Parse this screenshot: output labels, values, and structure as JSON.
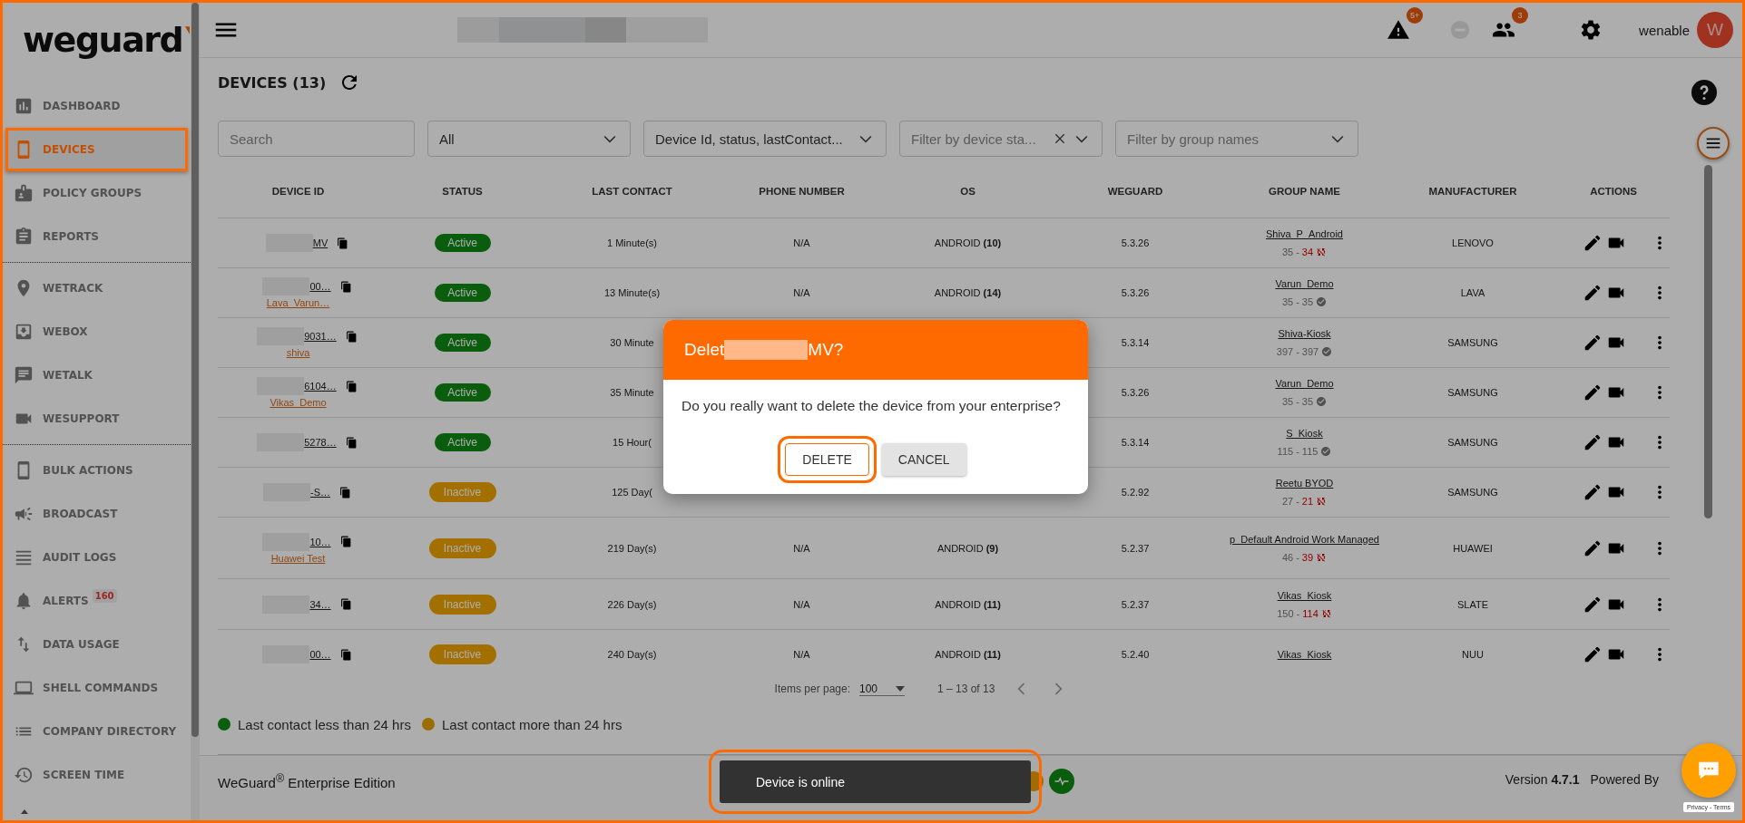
{
  "sidebar": {
    "logo": "weguard",
    "sections": [
      {
        "items": [
          {
            "label": "DASHBOARD",
            "selected": false
          },
          {
            "label": "DEVICES",
            "selected": true
          },
          {
            "label": "POLICY GROUPS",
            "selected": false
          },
          {
            "label": "REPORTS",
            "selected": false
          }
        ]
      },
      {
        "items": [
          {
            "label": "WETRACK",
            "selected": false
          },
          {
            "label": "WEBOX",
            "selected": false
          },
          {
            "label": "WETALK",
            "selected": false
          },
          {
            "label": "WESUPPORT",
            "selected": false
          }
        ]
      },
      {
        "items": [
          {
            "label": "BULK ACTIONS",
            "selected": false
          },
          {
            "label": "BROADCAST",
            "selected": false
          },
          {
            "label": "AUDIT LOGS",
            "selected": false
          },
          {
            "label": "ALERTS",
            "selected": false,
            "badge": "160"
          },
          {
            "label": "DATA USAGE",
            "selected": false
          },
          {
            "label": "SHELL COMMANDS",
            "selected": false
          },
          {
            "label": "COMPANY DIRECTORY",
            "selected": false
          },
          {
            "label": "SCREEN TIME",
            "selected": false
          }
        ]
      }
    ]
  },
  "header": {
    "alerts_badge": "5+",
    "users_badge": "3",
    "user_name": "wenable",
    "avatar_initial": "W"
  },
  "page": {
    "title": "DEVICES (13)"
  },
  "filters": [
    {
      "kind": "search",
      "placeholder": "Search"
    },
    {
      "kind": "select",
      "value": "All"
    },
    {
      "kind": "select",
      "value": "Device Id, status, lastContact..."
    },
    {
      "kind": "clearable",
      "placeholder": "Filter by device sta..."
    },
    {
      "kind": "select",
      "placeholder": "Filter by group names"
    }
  ],
  "table": {
    "columns": [
      "DEVICE ID",
      "STATUS",
      "LAST CONTACT",
      "PHONE NUMBER",
      "OS",
      "WEGUARD",
      "GROUP NAME",
      "MANUFACTURER",
      "ACTIONS"
    ],
    "rows": [
      {
        "device_id": "MV",
        "status": {
          "label": "Active",
          "active": true
        },
        "last_contact": "1 Minute(s)",
        "phone_number": "N/A",
        "os": "ANDROID **(10)**",
        "weguard": "5.3.26",
        "group_name": "Shiva_P_Android",
        "counts": {
          "total": "35",
          "separator": "-",
          "synced_count": "34",
          "synced": false
        },
        "manufacturer": "LENOVO"
      },
      {
        "device_id": "00…",
        "device_group": "Lava_Varun…",
        "status": {
          "label": "Active",
          "active": true
        },
        "last_contact": "13 Minute(s)",
        "phone_number": "N/A",
        "os": "ANDROID **(14)**",
        "weguard": "5.3.26",
        "group_name": "Varun_Demo",
        "counts": {
          "total": "35",
          "separator": "-",
          "synced_count": "35",
          "synced": true
        },
        "manufacturer": "LAVA"
      },
      {
        "device_id": "9031…",
        "device_group": "shiva",
        "status": {
          "label": "Active",
          "active": true
        },
        "last_contact": "30 Minute",
        "weguard": "5.3.14",
        "group_name": "Shiva-Kiosk",
        "counts": {
          "total": "397",
          "separator": "-",
          "synced_count": "397",
          "synced": true
        },
        "manufacturer": "SAMSUNG"
      },
      {
        "device_id": "6104…",
        "device_group": "Vikas_Demo",
        "status": {
          "label": "Active",
          "active": true
        },
        "last_contact": "35 Minute",
        "weguard": "5.3.26",
        "group_name": "Varun_Demo",
        "counts": {
          "total": "35",
          "separator": "-",
          "synced_count": "35",
          "synced": true
        },
        "manufacturer": "SAMSUNG"
      },
      {
        "device_id": "5278…",
        "status": {
          "label": "Active",
          "active": true
        },
        "last_contact": "15 Hour(",
        "weguard": "5.3.14",
        "group_name": "S_Kiosk",
        "counts": {
          "total": "115",
          "separator": "-",
          "synced_count": "115",
          "synced": true
        },
        "manufacturer": "SAMSUNG"
      },
      {
        "device_id": "-S…",
        "status": {
          "label": "Inactive",
          "active": false
        },
        "last_contact": "125 Day(",
        "weguard": "5.2.92",
        "group_name": "Reetu BYOD",
        "counts": {
          "total": "27",
          "separator": "-",
          "synced_count": "21",
          "synced": false
        },
        "manufacturer": "SAMSUNG"
      },
      {
        "device_id": "10…",
        "device_group": "Huawei Test",
        "status": {
          "label": "Inactive",
          "active": false
        },
        "last_contact": "219 Day(s)",
        "phone_number": "N/A",
        "os": "ANDROID **(9)**",
        "weguard": "5.2.37",
        "group_name": "p_Default Android Work Managed",
        "counts": {
          "total": "46",
          "separator": "-",
          "synced_count": "39",
          "synced": false
        },
        "manufacturer": "HUAWEI"
      },
      {
        "device_id": "34…",
        "status": {
          "label": "Inactive",
          "active": false
        },
        "last_contact": "226 Day(s)",
        "phone_number": "N/A",
        "os": "ANDROID **(11)**",
        "weguard": "5.2.37",
        "group_name": "Vikas_Kiosk",
        "counts": {
          "total": "150",
          "separator": "-",
          "synced_count": "114",
          "synced": false
        },
        "manufacturer": "SLATE"
      },
      {
        "device_id": "00…",
        "status": {
          "label": "Inactive",
          "active": false
        },
        "last_contact": "240 Day(s)",
        "phone_number": "N/A",
        "os": "ANDROID **(11)**",
        "weguard": "5.2.40",
        "group_name": "Vikas_Kiosk",
        "manufacturer": "NUU"
      }
    ]
  },
  "pagination": {
    "label": "Items per page:",
    "per_page": "100",
    "range": "1 – 13 of 13"
  },
  "legend": [
    {
      "label": "Last contact less than 24 hrs",
      "color": "#0a5f0f"
    },
    {
      "label": "Last contact more than 24 hrs",
      "color": "#9a6d00"
    }
  ],
  "footer": {
    "brand": "WeGuard$^{®}$ Enterprise Edition",
    "version": "Version **4.7.1**",
    "powered": "Powered By"
  },
  "dialog": {
    "title_start": "Delet",
    "title_end": "MV?",
    "message": "Do you really want to delete the device from your enterprise?",
    "buttons": [
      {
        "label": "DELETE",
        "kind": "primary"
      },
      {
        "label": "CANCEL",
        "kind": "secondary"
      }
    ]
  },
  "toast": {
    "message": "Device is online"
  },
  "recaptcha": "Privacy - Terms"
}
